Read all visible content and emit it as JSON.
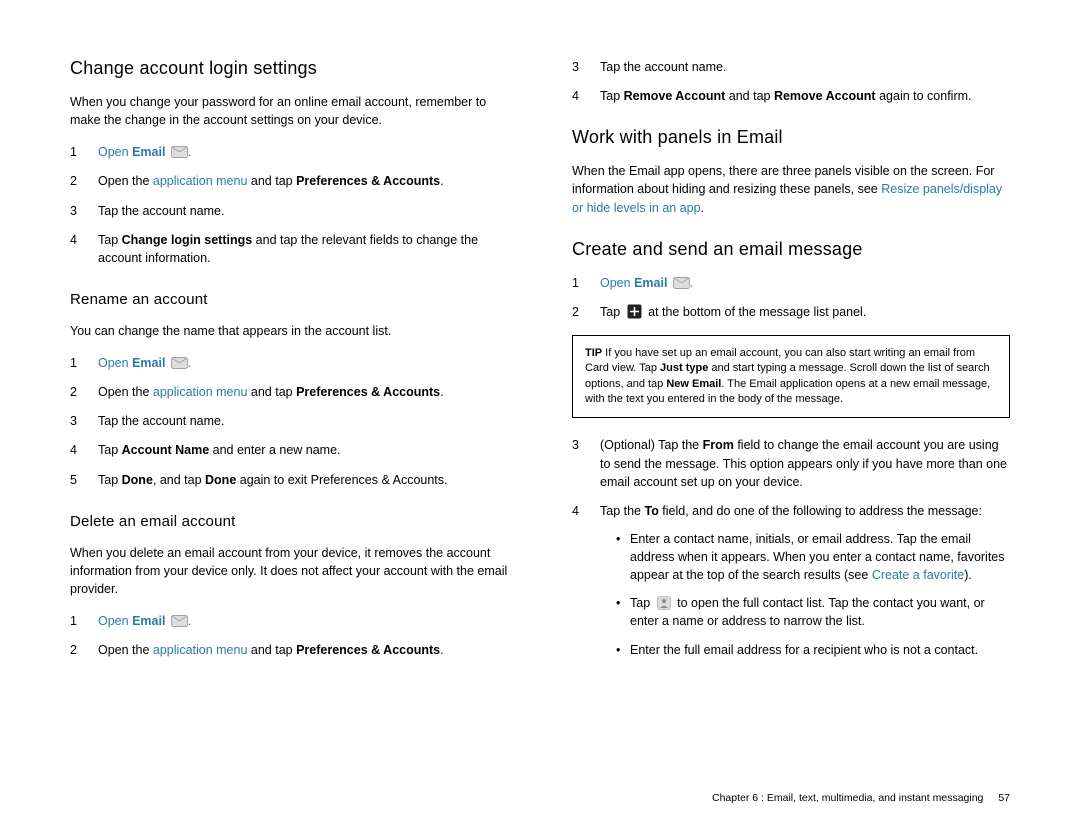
{
  "left": {
    "h1": "Change account login settings",
    "p1": "When you change your password for an online email account, remember to make the change in the account settings on your device.",
    "steps1": {
      "s1a": "Open ",
      "s1b": "Email",
      "s1c": " ",
      "s2a": "Open the ",
      "s2link": "application menu",
      "s2b": " and tap ",
      "s2bold": "Preferences & Accounts",
      "s2c": ".",
      "s3": "Tap the account name.",
      "s4a": "Tap ",
      "s4bold": "Change login settings",
      "s4b": " and tap the relevant fields to change the account information."
    },
    "h2": "Rename an account",
    "p2": "You can change the name that appears in the account list.",
    "steps2": {
      "s1a": "Open ",
      "s1b": "Email",
      "s1c": " ",
      "s2a": "Open the ",
      "s2link": "application menu",
      "s2b": " and tap ",
      "s2bold": "Preferences & Accounts",
      "s2c": ".",
      "s3": "Tap the account name.",
      "s4a": "Tap ",
      "s4bold": "Account Name",
      "s4b": " and enter a new name.",
      "s5a": "Tap ",
      "s5bold1": "Done",
      "s5b": ", and tap ",
      "s5bold2": "Done",
      "s5c": " again to exit Preferences & Accounts."
    },
    "h3": "Delete an email account",
    "p3": "When you delete an email account from your device, it removes the account information from your device only. It does not affect your account with the email provider.",
    "steps3": {
      "s1a": "Open ",
      "s1b": "Email",
      "s1c": " ",
      "s2a": "Open the ",
      "s2link": "application menu",
      "s2b": " and tap ",
      "s2bold": "Preferences & Accounts",
      "s2c": "."
    }
  },
  "right": {
    "steps_cont": {
      "s3": "Tap the account name.",
      "s4a": "Tap ",
      "s4bold1": "Remove Account",
      "s4b": " and tap ",
      "s4bold2": "Remove Account",
      "s4c": " again to confirm."
    },
    "h1": "Work with panels in Email",
    "p1a": "When the Email app opens, there are three panels visible on the screen. For information about hiding and resizing these panels, see ",
    "p1link": "Resize panels/display or hide levels in an app",
    "p1b": ".",
    "h2": "Create and send an email message",
    "steps1": {
      "s1a": "Open ",
      "s1b": "Email",
      "s1c": " ",
      "s2a": "Tap ",
      "s2b": " at the bottom of the message list panel."
    },
    "tip": {
      "label": "TIP",
      "a": " If you have set up an email account, you can also start writing an email from Card view. Tap ",
      "b1": "Just type",
      "c": " and start typing a message. Scroll down the list of search options, and tap ",
      "b2": "New Email",
      "d": ". The Email application opens at a new email message, with the text you entered in the body of the message."
    },
    "steps2": {
      "s3a": "(Optional) Tap the ",
      "s3bold": "From",
      "s3b": " field to change the email account you are using to send the message. This option appears only if you have more than one email account set up on your device.",
      "s4a": "Tap the ",
      "s4bold": "To",
      "s4b": " field, and do one of the following to address the message:"
    },
    "bullets": {
      "b1a": "Enter a contact name, initials, or email address. Tap the email address when it appears. When you enter a contact name, favorites appear at the top of the search results (see ",
      "b1link": "Create a favorite",
      "b1b": ").",
      "b2a": "Tap ",
      "b2b": " to open the full contact list. Tap the contact you want, or enter a name or address to narrow the list.",
      "b3": "Enter the full email address for a recipient who is not a contact."
    }
  },
  "footer": {
    "chapter": "Chapter 6 : Email, text, multimedia, and instant messaging",
    "page": "57"
  }
}
